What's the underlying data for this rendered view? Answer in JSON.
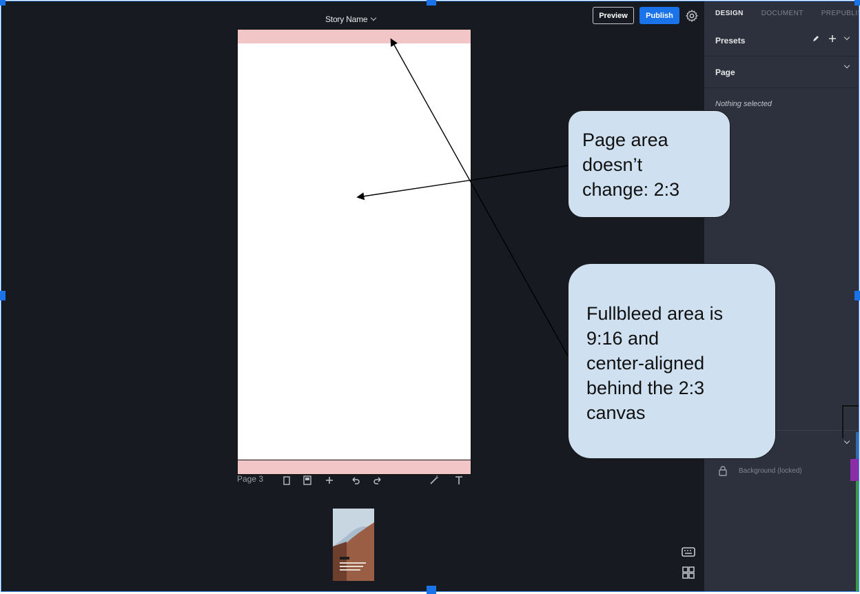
{
  "header": {
    "story_name": "Story Name",
    "preview_label": "Preview",
    "publish_label": "Publish"
  },
  "canvas": {
    "page_label": "Page 3"
  },
  "panel": {
    "tabs": [
      {
        "label": "DESIGN",
        "active": true
      },
      {
        "label": "DOCUMENT",
        "active": false
      },
      {
        "label": "PREPUBLISH",
        "active": false
      }
    ],
    "presets_label": "Presets",
    "page_section_label": "Page",
    "nothing_selected": "Nothing selected",
    "layer_background": "Background (locked)"
  },
  "annotations": {
    "bubble_1": [
      "Page area",
      "doesn’t",
      "change: 2:3"
    ],
    "bubble_2": [
      "Fullbleed area is",
      "9:16 and",
      "center-aligned",
      "behind the 2:3",
      "canvas"
    ]
  },
  "colors": {
    "background": "#171a21",
    "panel": "#2d313d",
    "accent": "#1a73e8",
    "bleed": "#f2c6c6",
    "bubble": "#cfe0f0"
  }
}
